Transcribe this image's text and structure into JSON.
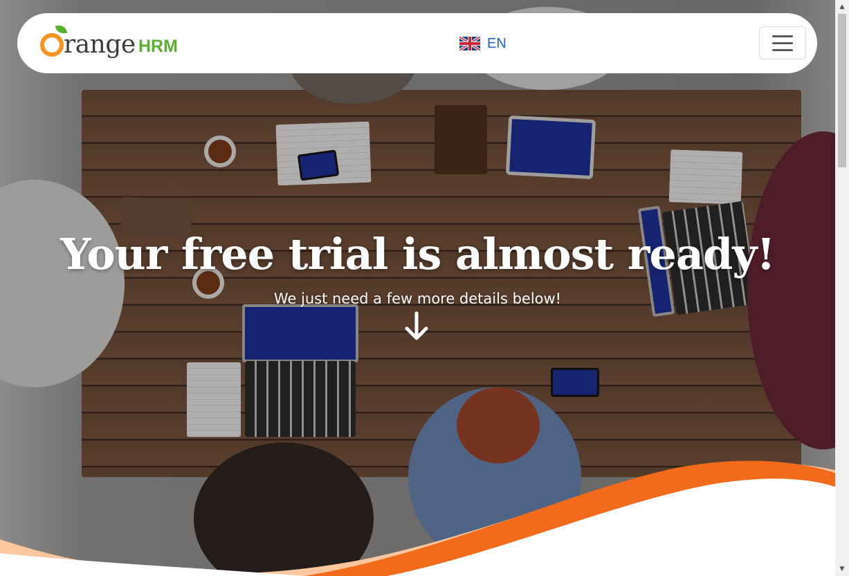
{
  "brand": {
    "logo_letters": "range",
    "logo_suffix": "HRM",
    "logo_alt": "OrangeHRM"
  },
  "nav": {
    "language_code": "EN",
    "menu_icon": "hamburger-menu-icon",
    "flag_icon": "uk-flag-icon"
  },
  "hero": {
    "headline": "Your free trial is almost ready!",
    "subheadline": "We just need a few more details below!",
    "scroll_icon": "arrow-down-icon"
  },
  "colors": {
    "orange": "#f7931e",
    "orange_dark": "#f26b1d",
    "green": "#5ab031",
    "link_blue": "#1e62c8",
    "peach": "#fcc79e"
  }
}
